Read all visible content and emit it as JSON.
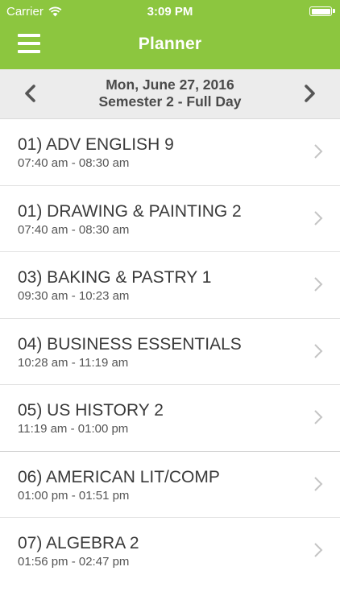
{
  "status_bar": {
    "carrier": "Carrier",
    "time": "3:09 PM",
    "battery_level": 1.0
  },
  "nav": {
    "title": "Planner"
  },
  "date_header": {
    "date": "Mon, June 27, 2016",
    "schedule": "Semester 2 - Full Day"
  },
  "colors": {
    "accent": "#8cc63f",
    "header_bg": "#ececec"
  },
  "icons": {
    "menu": "hamburger-icon",
    "prev": "chevron-left-icon",
    "next": "chevron-right-icon",
    "row": "chevron-right-icon"
  },
  "classes": [
    {
      "name": "01) ADV ENGLISH 9",
      "time": "07:40 am - 08:30 am"
    },
    {
      "name": "01) DRAWING & PAINTING 2",
      "time": "07:40 am - 08:30 am"
    },
    {
      "name": "03) BAKING & PASTRY 1",
      "time": "09:30 am - 10:23 am"
    },
    {
      "name": "04) BUSINESS ESSENTIALS",
      "time": "10:28 am - 11:19 am"
    },
    {
      "name": "05) US HISTORY 2",
      "time": "11:19 am - 01:00 pm"
    },
    {
      "name": "06) AMERICAN LIT/COMP",
      "time": "01:00 pm - 01:51 pm"
    },
    {
      "name": "07) ALGEBRA 2",
      "time": "01:56 pm - 02:47 pm"
    }
  ]
}
